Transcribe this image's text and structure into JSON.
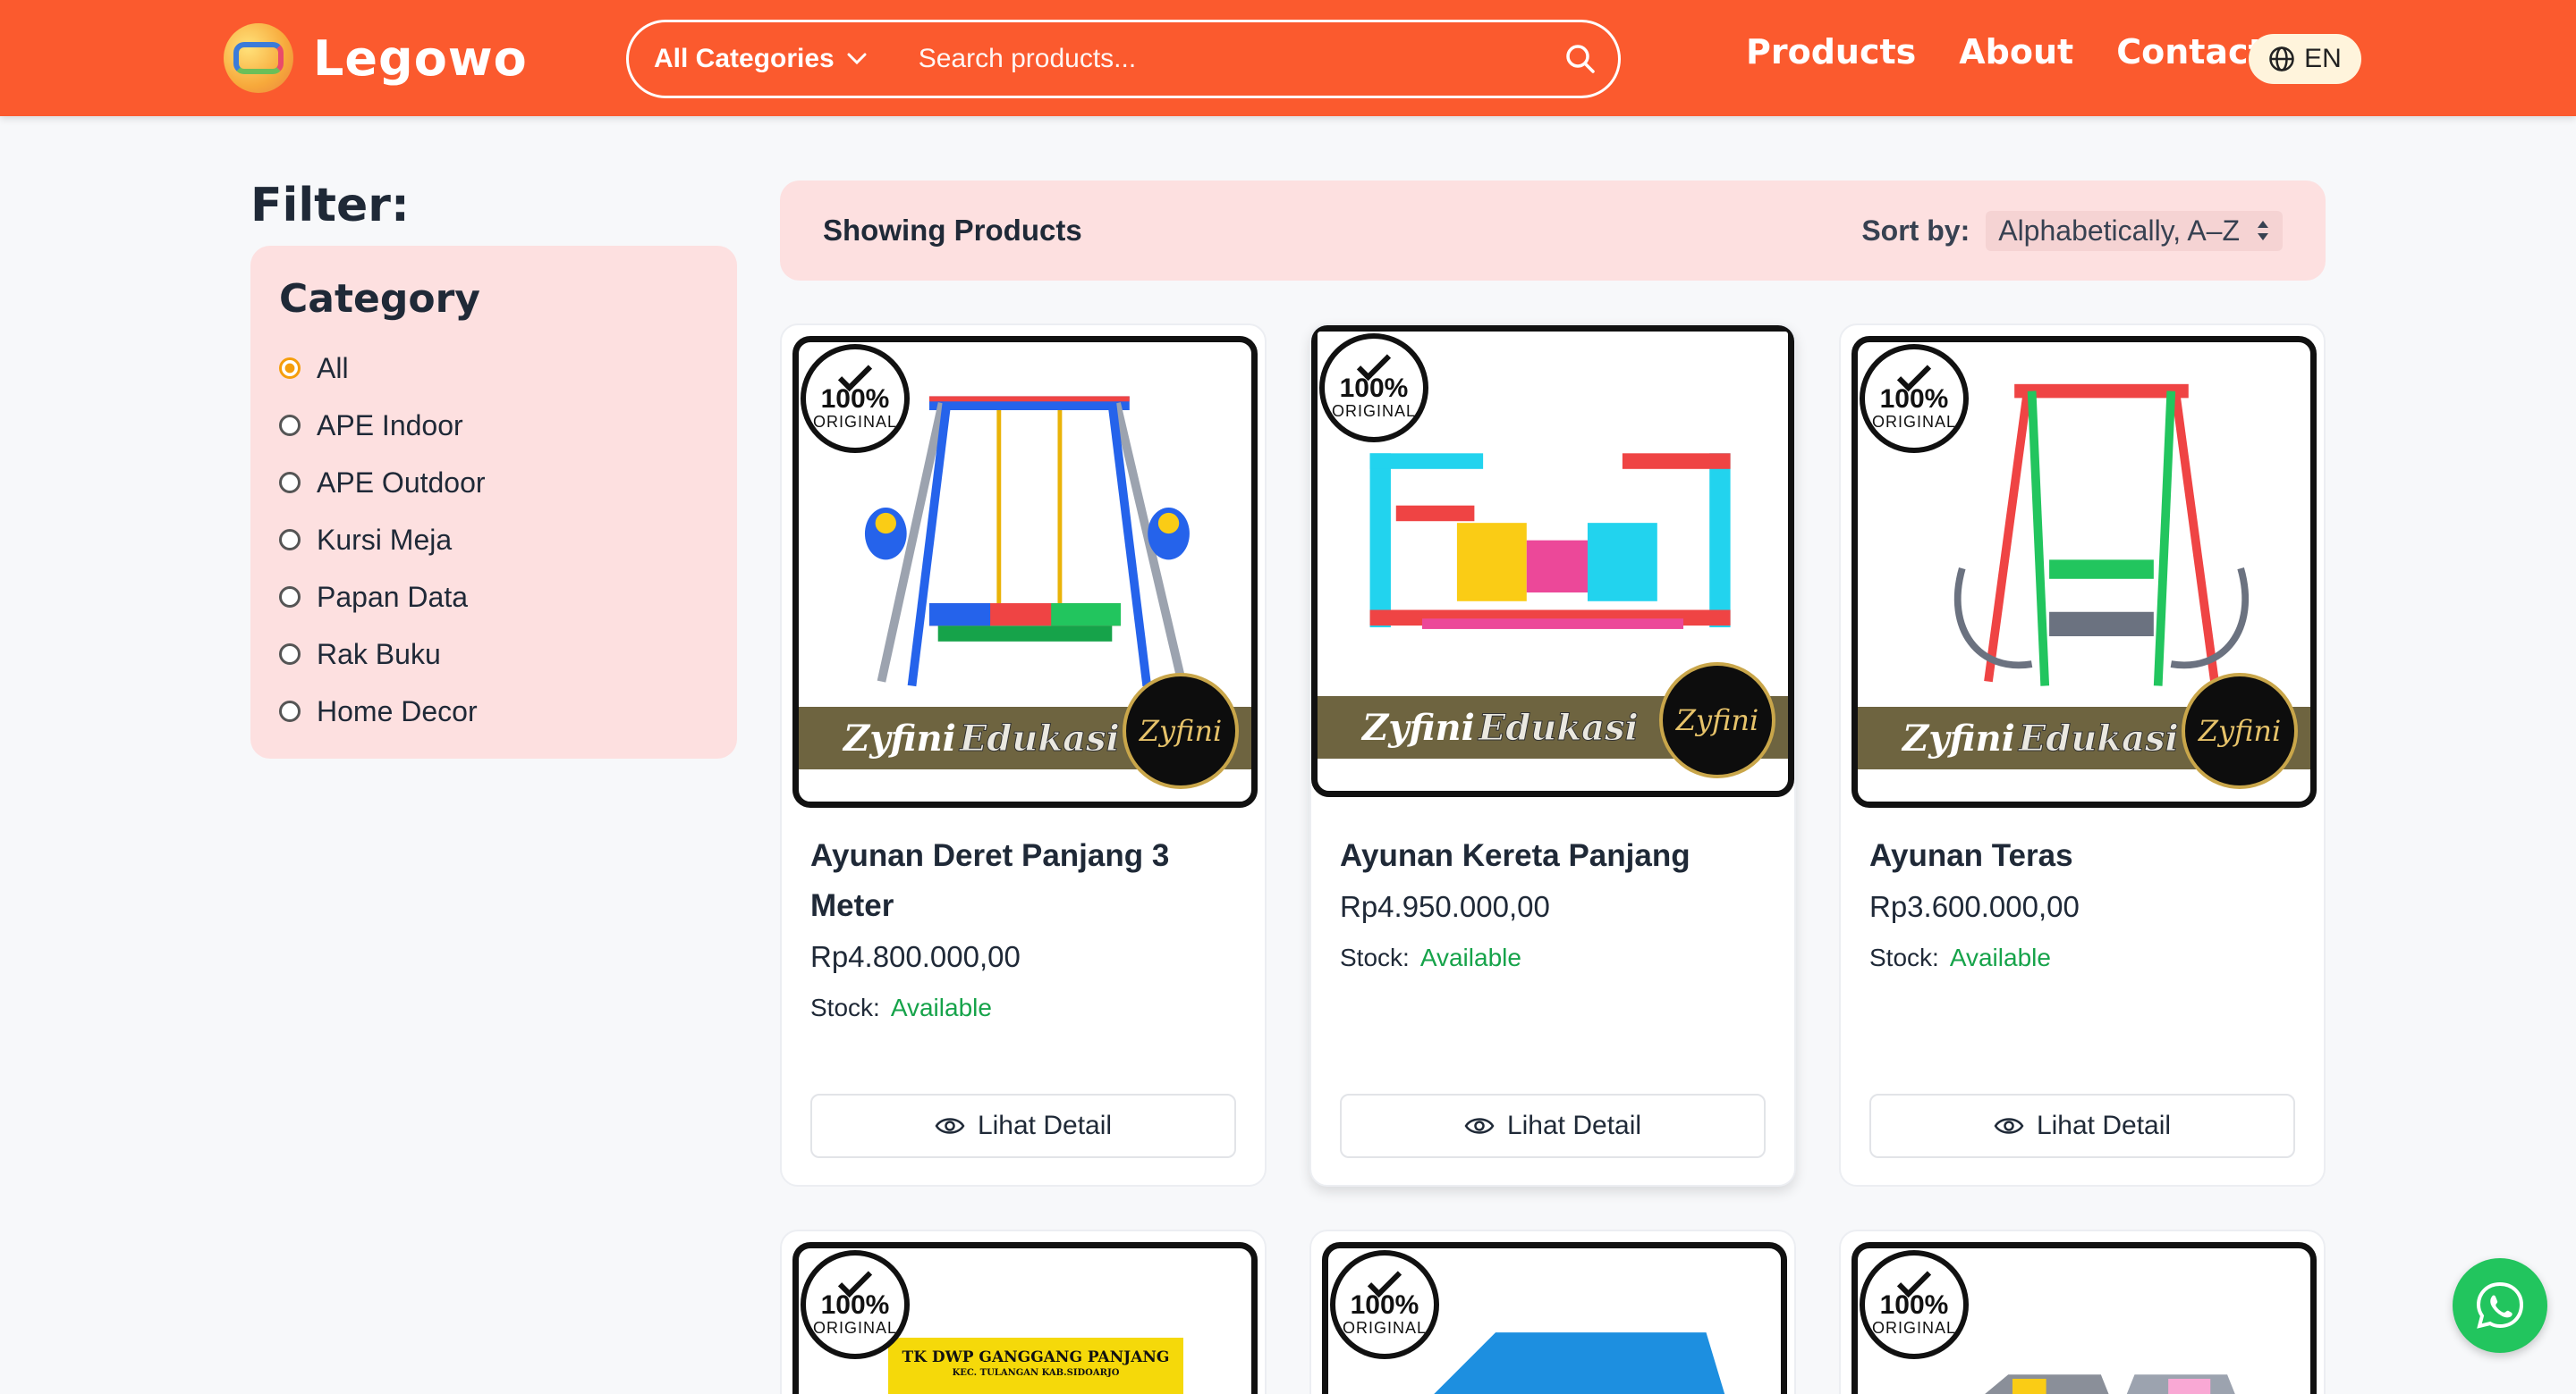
{
  "header": {
    "brand": "Legowo",
    "search": {
      "category_label": "All Categories",
      "placeholder": "Search products..."
    },
    "nav": [
      "Products",
      "About",
      "Contact"
    ],
    "language": "EN",
    "accent_color": "#fb5a2e"
  },
  "sidebar": {
    "title": "Filter:",
    "category_title": "Category",
    "categories": [
      {
        "label": "All",
        "selected": true
      },
      {
        "label": "APE Indoor",
        "selected": false
      },
      {
        "label": "APE Outdoor",
        "selected": false
      },
      {
        "label": "Kursi Meja",
        "selected": false
      },
      {
        "label": "Papan Data",
        "selected": false
      },
      {
        "label": "Rak Buku",
        "selected": false
      },
      {
        "label": "Home Decor",
        "selected": false
      }
    ]
  },
  "toolbar": {
    "showing_label": "Showing Products",
    "sort_label": "Sort by:",
    "sort_value": "Alphabetically, A–Z"
  },
  "badge": {
    "percent": "100%",
    "text": "ORIGINAL"
  },
  "brand_strip": {
    "part1": "Zyfini",
    "part2": "Edukasi",
    "seal": "Zyfini"
  },
  "products": [
    {
      "name": "Ayunan Deret Panjang 3 Meter",
      "price": "Rp4.800.000,00",
      "stock_label": "Stock:",
      "stock_value": "Available",
      "button": "Lihat Detail"
    },
    {
      "name": "Ayunan Kereta Panjang",
      "price": "Rp4.950.000,00",
      "stock_label": "Stock:",
      "stock_value": "Available",
      "button": "Lihat Detail"
    },
    {
      "name": "Ayunan Teras",
      "price": "Rp3.600.000,00",
      "stock_label": "Stock:",
      "stock_value": "Available",
      "button": "Lihat Detail"
    }
  ],
  "partial_products": [
    {
      "sign_title": "TK DWP GANGGANG PANJANG",
      "sign_sub": "KEC. TULANGAN KAB.SIDOARJO"
    },
    {},
    {}
  ]
}
